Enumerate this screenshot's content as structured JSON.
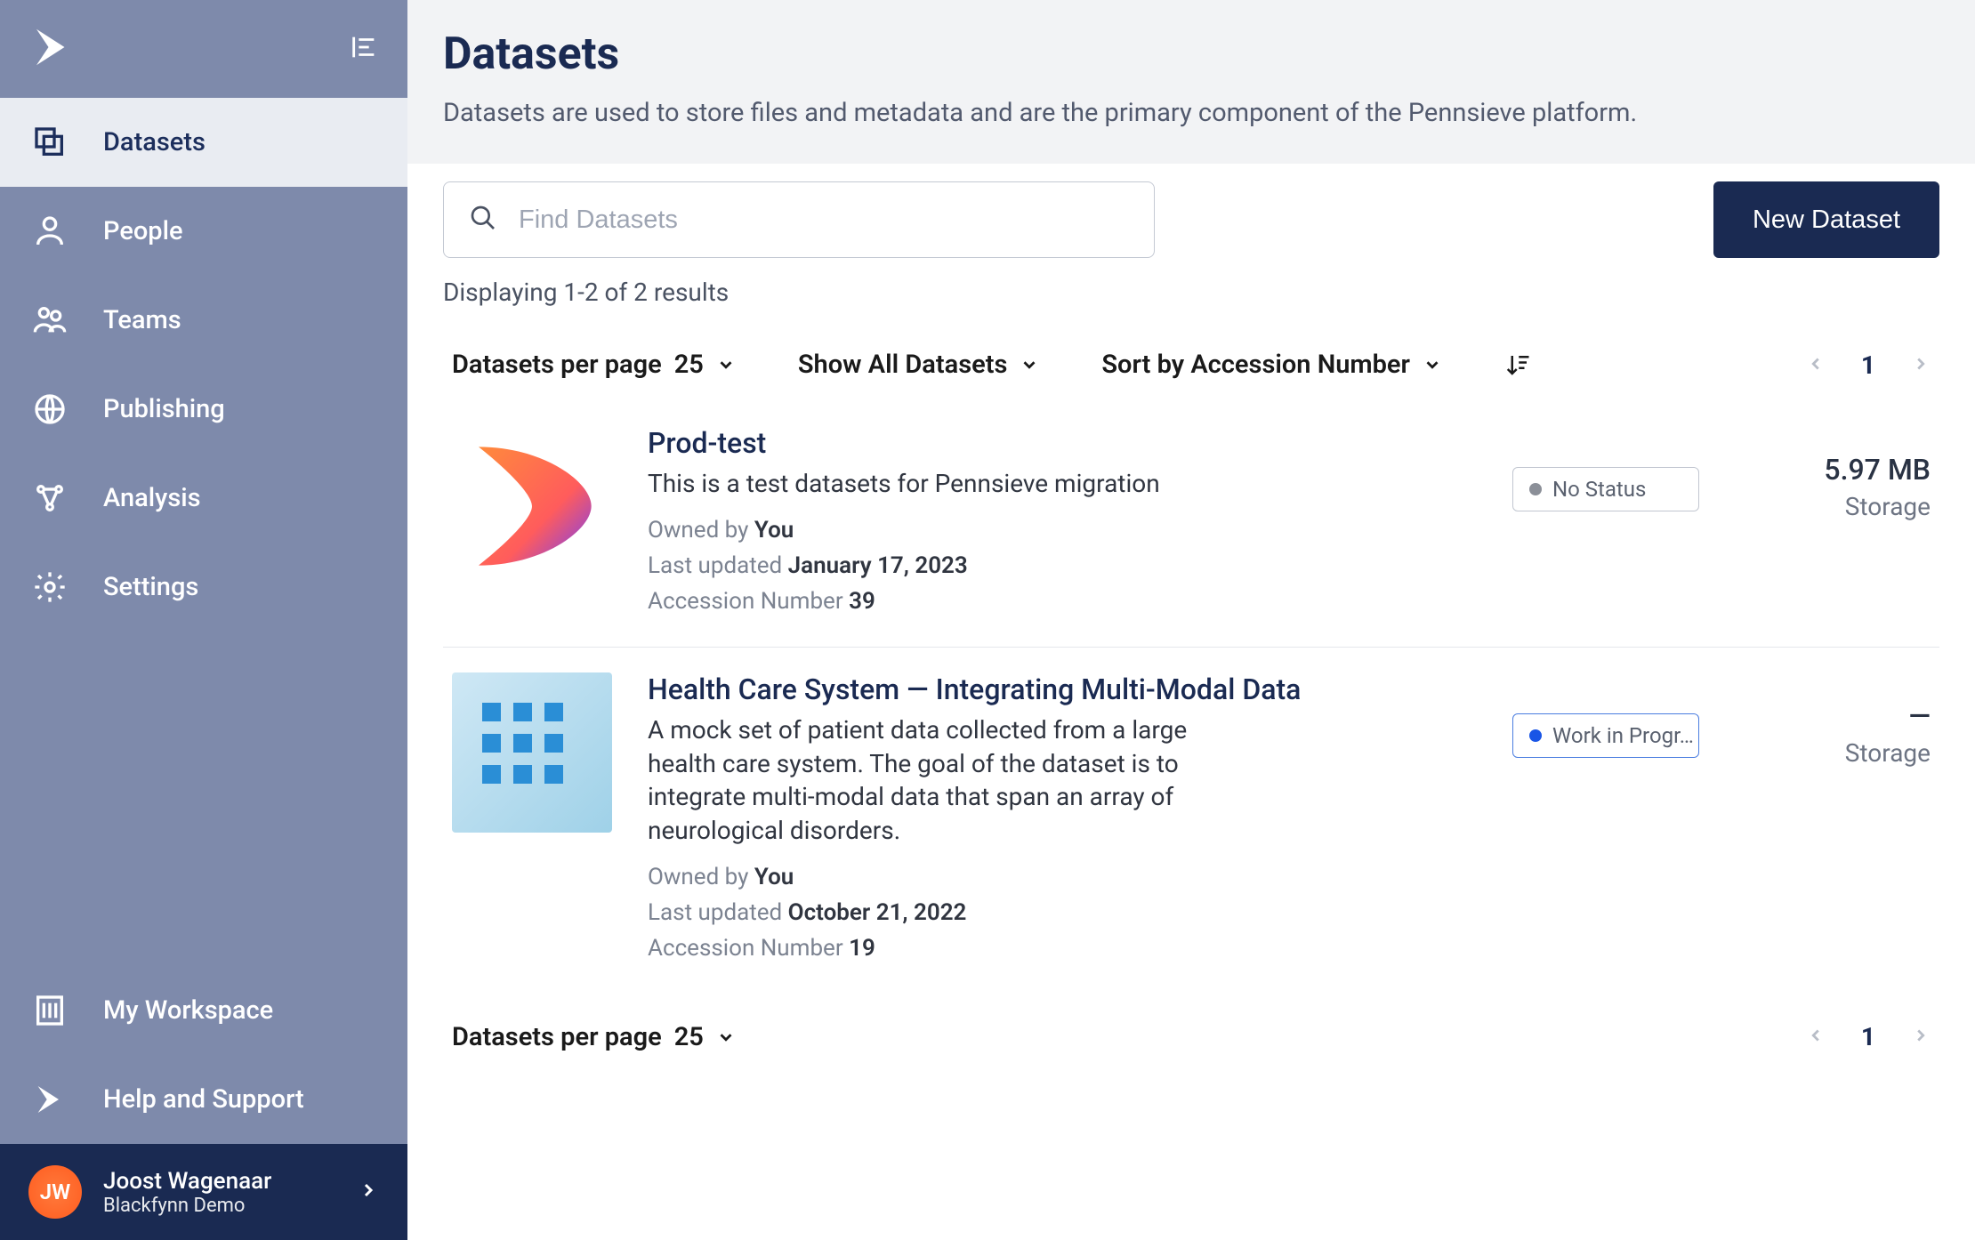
{
  "sidebar": {
    "items": [
      {
        "label": "Datasets",
        "icon": "layers"
      },
      {
        "label": "People",
        "icon": "person"
      },
      {
        "label": "Teams",
        "icon": "people"
      },
      {
        "label": "Publishing",
        "icon": "globe"
      },
      {
        "label": "Analysis",
        "icon": "graph"
      },
      {
        "label": "Settings",
        "icon": "gear"
      }
    ],
    "bottom": [
      {
        "label": "My Workspace",
        "icon": "building"
      },
      {
        "label": "Help and Support",
        "icon": "logo"
      }
    ],
    "user": {
      "initials": "JW",
      "name": "Joost Wagenaar",
      "org": "Blackfynn Demo"
    }
  },
  "header": {
    "title": "Datasets",
    "subtitle": "Datasets are used to store files and metadata and are the primary component of the Pennsieve platform."
  },
  "search": {
    "placeholder": "Find Datasets"
  },
  "new_button": "New Dataset",
  "results_text": "Displaying 1-2 of 2 results",
  "controls": {
    "per_page_label": "Datasets per page",
    "per_page_value": "25",
    "show_label": "Show All Datasets",
    "sort_label": "Sort by Accession Number"
  },
  "pager": {
    "page": "1"
  },
  "datasets": [
    {
      "title": "Prod-test",
      "desc": "This is a test datasets for Pennsieve migration",
      "owned_by_label": "Owned by",
      "owner": "You",
      "updated_label": "Last updated",
      "updated": "January 17, 2023",
      "accession_label": "Accession Number",
      "accession": "39",
      "status_text": "No Status",
      "status_color": "#8b8f98",
      "storage": "5.97 MB",
      "storage_label": "Storage",
      "thumb": "logo"
    },
    {
      "title": "Health Care System — Integrating Multi-Modal Data",
      "desc": "A mock set of patient data collected from a large health care system. The goal of the dataset is to integrate multi-modal data that span an array of neurological disorders.",
      "owned_by_label": "Owned by",
      "owner": "You",
      "updated_label": "Last updated",
      "updated": "October 21, 2022",
      "accession_label": "Accession Number",
      "accession": "19",
      "status_text": "Work in Progr…",
      "status_color": "#1955e6",
      "storage": "—",
      "storage_label": "Storage",
      "thumb": "health"
    }
  ],
  "bottom_per_page_label": "Datasets per page",
  "bottom_per_page_value": "25"
}
